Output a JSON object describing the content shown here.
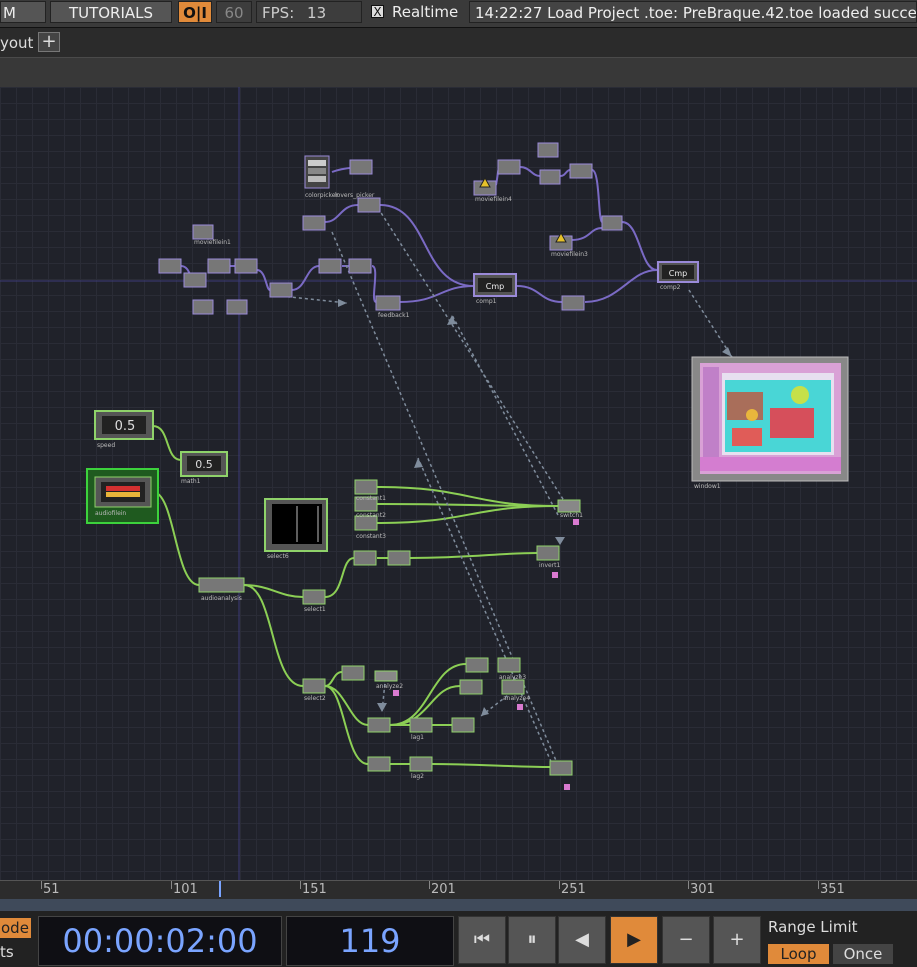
{
  "topbar": {
    "menu_fragment": "M",
    "tutorials": "TUTORIALS",
    "oi": "O|I",
    "fps_cap": "60",
    "fps_label": "FPS:",
    "fps_value": "13",
    "realtime_check": "X",
    "realtime_label": "Realtime",
    "status": "14:22:27 Load Project .toe: PreBraque.42.toe loaded succe"
  },
  "panebar": {
    "layout_label": "yout",
    "add_label": "+"
  },
  "nodes": {
    "colors": {
      "top": "#9a8ad8",
      "chop": "#8fd26a",
      "wire_top": "#7a6ac4",
      "wire_chop": "#8ccf55",
      "selected": "#3cd23c"
    },
    "cmp_label": "Cmp",
    "speed_value": "0.5",
    "math_value": "0.5",
    "names": {
      "moviefilein1": "moviefilein1",
      "moviefilein4": "moviefilein4",
      "moviefilein3": "moviefilein3",
      "colorpicker": "colorpicker",
      "lovers_picker": "lovers_picker",
      "feedback1": "feedback1",
      "comp1": "comp1",
      "comp2": "comp2",
      "window1": "window1",
      "switch1": "switch1",
      "select6": "select6",
      "audioanalysis": "audioanalysis",
      "constant1": "constant1",
      "constant2": "constant2",
      "constant3": "constant3",
      "invert1": "invert1",
      "select1": "select1",
      "select2": "select2",
      "math1": "math1",
      "analyze2": "analyze2",
      "analyze3": "analyze3",
      "analyze4": "analyze4",
      "lag1": "lag1",
      "lag2": "lag2",
      "speed": "speed",
      "audiofilein": "audiofilein"
    }
  },
  "timeline": {
    "ticks": [
      "51",
      "101",
      "151",
      "201",
      "251",
      "301",
      "351"
    ]
  },
  "bottom": {
    "mode_label": "ode",
    "ts_label": "ts",
    "timecode": "00:00:02:00",
    "frame": "119",
    "range_limit": "Range Limit",
    "loop": "Loop",
    "once": "Once"
  }
}
